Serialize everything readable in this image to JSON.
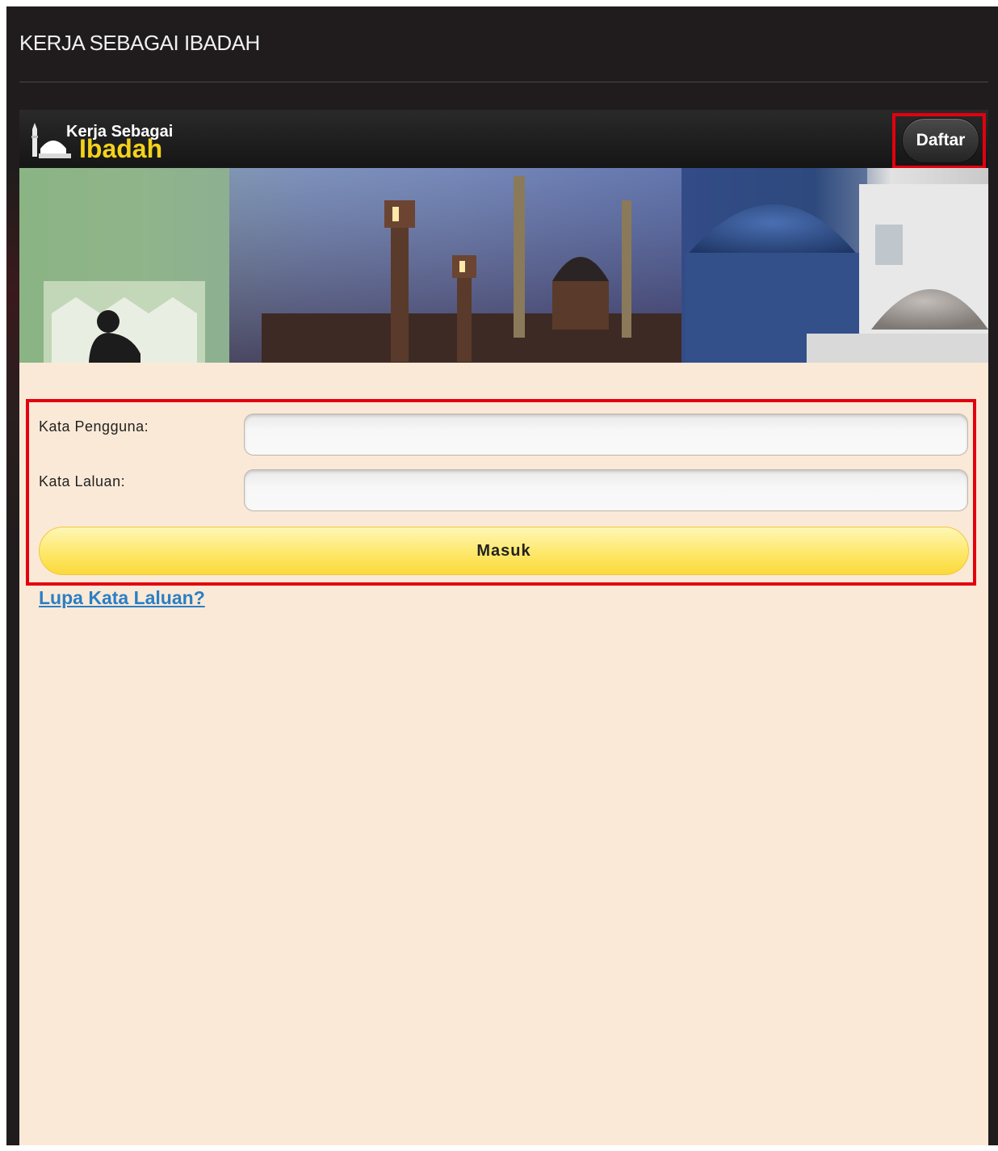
{
  "page": {
    "title": "KERJA SEBAGAI IBADAH"
  },
  "header": {
    "logo_line1": "Kerja Sebagai",
    "logo_line2": "Ibadah",
    "register_label": "Daftar"
  },
  "banner": {
    "icon": "mosque-banner-image"
  },
  "login_form": {
    "username_label": "Kata Pengguna:",
    "username_value": "",
    "password_label": "Kata Laluan:",
    "password_value": "",
    "submit_label": "Masuk",
    "forgot_label": "Lupa Kata Laluan?"
  },
  "colors": {
    "highlight": "#e3000f",
    "accent_yellow": "#fde86a",
    "link": "#2a7fc4",
    "content_bg": "#fbe9d7"
  }
}
